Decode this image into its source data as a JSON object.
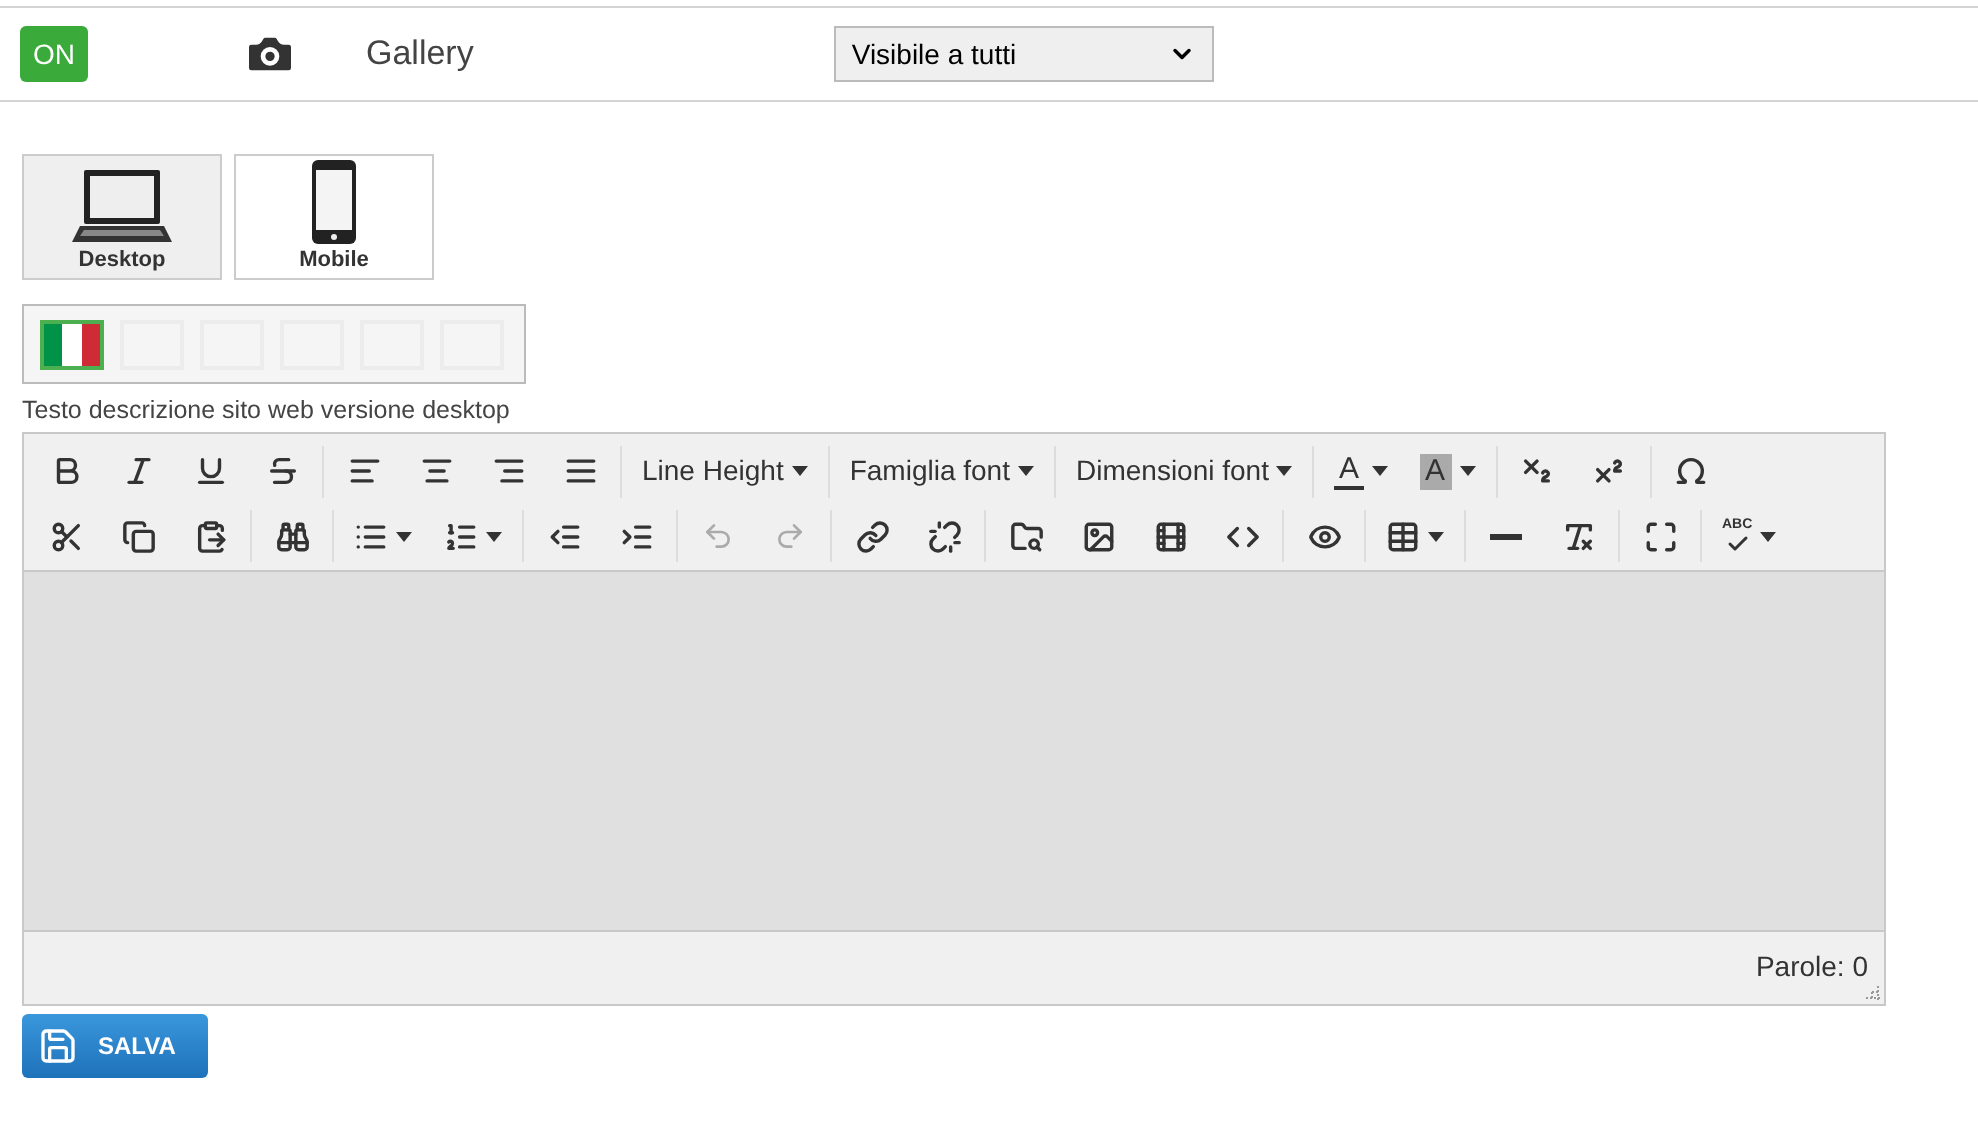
{
  "header": {
    "status": {
      "label": "ON",
      "on": true
    },
    "title": "Gallery",
    "visibility": {
      "value": "Visibile a tutti"
    }
  },
  "devices": [
    {
      "label": "Desktop",
      "kind": "desktop",
      "selected": true
    },
    {
      "label": "Mobile",
      "kind": "mobile",
      "selected": false
    }
  ],
  "languages": [
    {
      "kind": "flag",
      "selected": true
    },
    {
      "kind": "empty",
      "selected": false
    },
    {
      "kind": "empty",
      "selected": false
    },
    {
      "kind": "empty",
      "selected": false
    },
    {
      "kind": "empty",
      "selected": false
    },
    {
      "kind": "empty",
      "selected": false
    }
  ],
  "editor": {
    "label": "Testo descrizione sito web versione desktop",
    "toolbar": {
      "line_height": "Line Height",
      "font_family": "Famiglia font",
      "font_size": "Dimensioni font",
      "text_color": "A",
      "background_color": "A",
      "spellcheck": "ABC"
    },
    "word_count": "Parole: 0"
  },
  "save_button": "SALVA"
}
